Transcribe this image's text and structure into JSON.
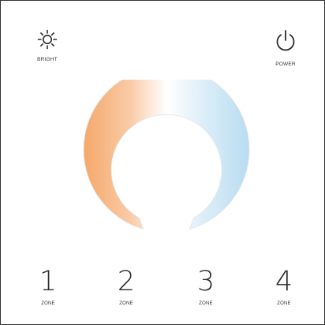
{
  "top_buttons": {
    "bright": {
      "label": "BRIGHT",
      "icon": "sun-icon"
    },
    "power": {
      "label": "POWER",
      "icon": "power-icon"
    }
  },
  "color_ring": {
    "warm_color": "#F5A86A",
    "neutral_color": "#FFFFFF",
    "cool_color": "#B8DCF2"
  },
  "zones": [
    {
      "number": "1",
      "label": "ZONE"
    },
    {
      "number": "2",
      "label": "ZONE"
    },
    {
      "number": "3",
      "label": "ZONE"
    },
    {
      "number": "4",
      "label": "ZONE"
    }
  ]
}
